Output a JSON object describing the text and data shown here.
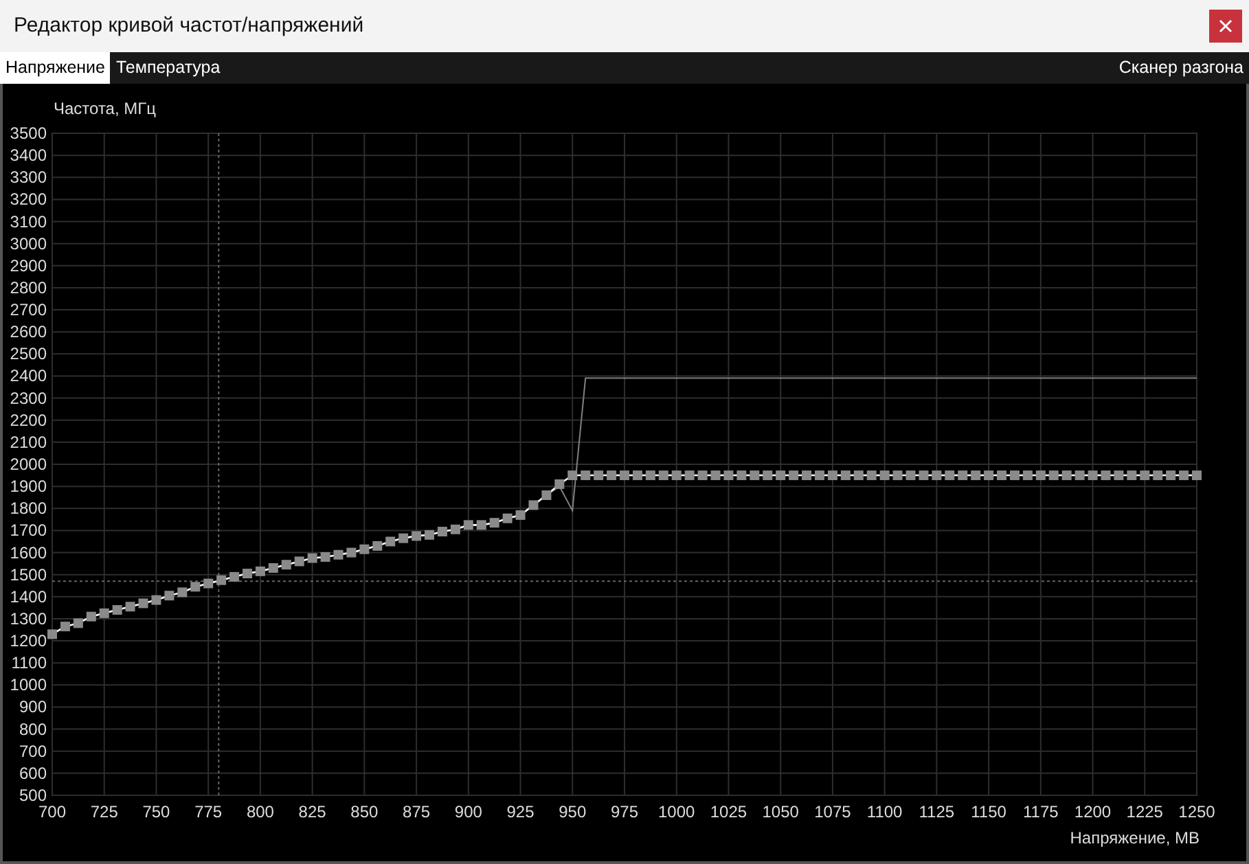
{
  "window": {
    "title": "Редактор кривой частот/напряжений"
  },
  "tabs": [
    {
      "label": "Напряжение",
      "selected": true
    },
    {
      "label": "Температура",
      "selected": false
    }
  ],
  "scanner_tab": {
    "label": "Сканер разгона"
  },
  "chart": {
    "chart_data": {
      "type": "line",
      "xlabel": "Напряжение, МВ",
      "ylabel": "Частота, МГц",
      "xlim": [
        700,
        1250
      ],
      "ylim": [
        500,
        3500
      ],
      "xticks": [
        700,
        725,
        750,
        775,
        800,
        825,
        850,
        875,
        900,
        925,
        950,
        975,
        1000,
        1025,
        1050,
        1075,
        1100,
        1125,
        1150,
        1175,
        1200,
        1225,
        1250
      ],
      "yticks": [
        500,
        600,
        700,
        800,
        900,
        1000,
        1100,
        1200,
        1300,
        1400,
        1500,
        1600,
        1700,
        1800,
        1900,
        2000,
        2100,
        2200,
        2300,
        2400,
        2500,
        2600,
        2700,
        2800,
        2900,
        3000,
        3100,
        3200,
        3300,
        3400,
        3500
      ],
      "x": [
        700,
        706.25,
        712.5,
        718.75,
        725,
        731.25,
        737.5,
        743.75,
        750,
        756.25,
        762.5,
        768.75,
        775,
        781.25,
        787.5,
        793.75,
        800,
        806.25,
        812.5,
        818.75,
        825,
        831.25,
        837.5,
        843.75,
        850,
        856.25,
        862.5,
        868.75,
        875,
        881.25,
        887.5,
        893.75,
        900,
        906.25,
        912.5,
        918.75,
        925,
        931.25,
        937.5,
        943.75,
        950,
        956.25,
        962.5,
        968.75,
        975,
        981.25,
        987.5,
        993.75,
        1000,
        1006.25,
        1012.5,
        1018.75,
        1025,
        1031.25,
        1037.5,
        1043.75,
        1050,
        1056.25,
        1062.5,
        1068.75,
        1075,
        1081.25,
        1087.5,
        1093.75,
        1100,
        1106.25,
        1112.5,
        1118.75,
        1125,
        1131.25,
        1137.5,
        1143.75,
        1150,
        1156.25,
        1162.5,
        1168.75,
        1175,
        1181.25,
        1187.5,
        1193.75,
        1200,
        1206.25,
        1212.5,
        1218.75,
        1225,
        1231.25,
        1237.5,
        1243.75,
        1250
      ],
      "series": [
        {
          "color": "#ffffff",
          "values": [
            1230,
            1265,
            1280,
            1310,
            1325,
            1340,
            1355,
            1370,
            1385,
            1405,
            1420,
            1445,
            1460,
            1475,
            1490,
            1505,
            1515,
            1530,
            1545,
            1560,
            1575,
            1580,
            1590,
            1600,
            1615,
            1630,
            1650,
            1665,
            1675,
            1680,
            1695,
            1705,
            1725,
            1725,
            1735,
            1755,
            1770,
            1815,
            1860,
            1910,
            1950,
            1950,
            1950,
            1950,
            1950,
            1950,
            1950,
            1950,
            1950,
            1950,
            1950,
            1950,
            1950,
            1950,
            1950,
            1950,
            1950,
            1950,
            1950,
            1950,
            1950,
            1950,
            1950,
            1950,
            1950,
            1950,
            1950,
            1950,
            1950,
            1950,
            1950,
            1950,
            1950,
            1950,
            1950,
            1950,
            1950,
            1950,
            1950,
            1950,
            1950,
            1950,
            1950,
            1950,
            1950,
            1950,
            1950,
            1950,
            1950
          ]
        },
        {
          "color": "#808080",
          "values": [
            1230,
            1265,
            1280,
            1310,
            1325,
            1340,
            1355,
            1370,
            1385,
            1405,
            1420,
            1445,
            1460,
            1475,
            1490,
            1505,
            1515,
            1530,
            1545,
            1560,
            1575,
            1580,
            1590,
            1600,
            1615,
            1630,
            1650,
            1665,
            1675,
            1680,
            1695,
            1705,
            1725,
            1725,
            1735,
            1755,
            1770,
            1815,
            1860,
            1900,
            1790,
            2390,
            2390,
            2390,
            2390,
            2390,
            2390,
            2390,
            2390,
            2390,
            2390,
            2390,
            2390,
            2390,
            2390,
            2390,
            2390,
            2390,
            2390,
            2390,
            2390,
            2390,
            2390,
            2390,
            2390,
            2390,
            2390,
            2390,
            2390,
            2390,
            2390,
            2390,
            2390,
            2390,
            2390,
            2390,
            2390,
            2390,
            2390,
            2390,
            2390,
            2390,
            2390,
            2390,
            2390,
            2390,
            2390,
            2390,
            2390
          ]
        }
      ],
      "grid": true,
      "ref_lines": [
        {
          "axis": "x",
          "value": 780
        },
        {
          "axis": "y",
          "value": 1470
        }
      ]
    }
  }
}
